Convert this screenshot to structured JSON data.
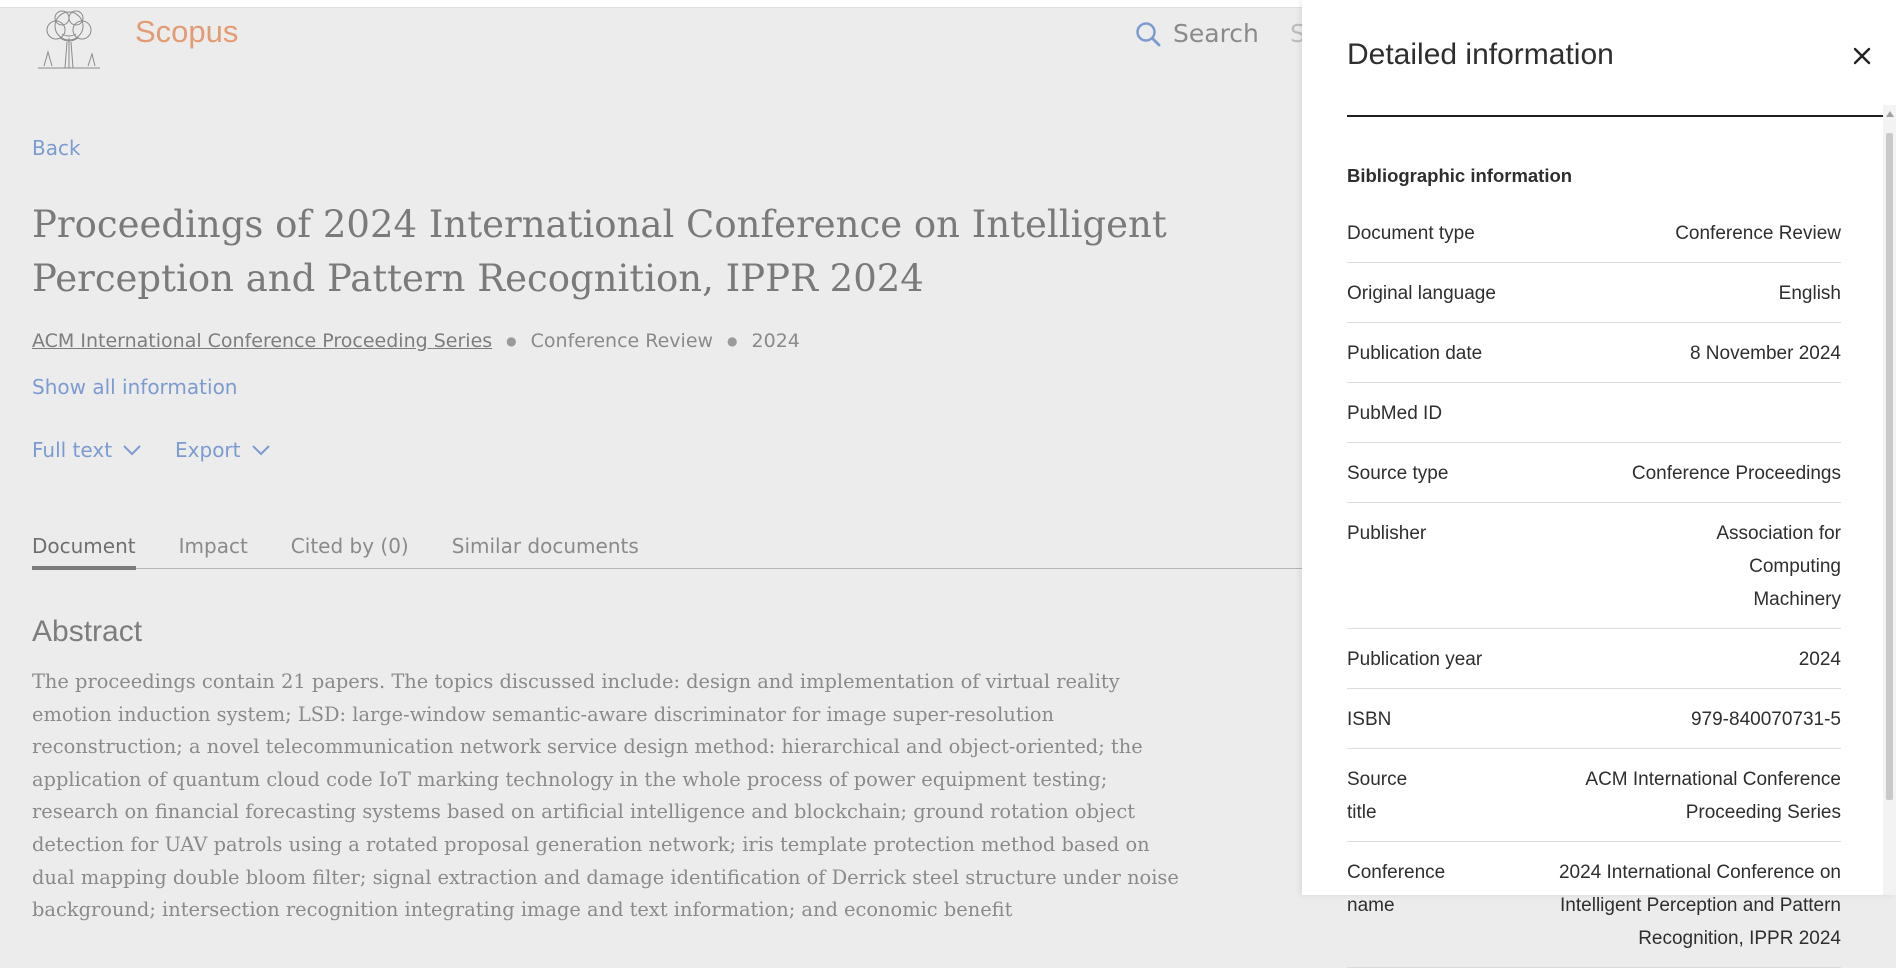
{
  "header": {
    "brand": "Scopus",
    "search_label": "Search",
    "search_next_cut": "S"
  },
  "nav": {
    "back_label": "Back"
  },
  "document": {
    "title": "Proceedings of 2024 International Conference on Intelligent Perception and Pattern Recognition, IPPR 2024",
    "source": "ACM International Conference Proceeding Series",
    "doc_type": "Conference Review",
    "year": "2024",
    "show_all": "Show all information",
    "actions": {
      "full_text": "Full text",
      "export": "Export"
    },
    "tabs": [
      "Document",
      "Impact",
      "Cited by (0)",
      "Similar documents"
    ],
    "abstract_heading": "Abstract",
    "abstract_text": "The proceedings contain 21 papers. The topics discussed include: design and implementation of virtual reality emotion induction system; LSD: large-window semantic-aware discriminator for image super-resolution reconstruction; a novel telecommunication network service design method: hierarchical and object-oriented; the application of quantum cloud code IoT marking technology in the whole process of power equipment testing; research on financial forecasting systems based on artificial intelligence and blockchain; ground rotation object detection for UAV patrols using a rotated proposal generation network; iris template protection method based on dual mapping double bloom filter; signal extraction and damage identification of Derrick steel structure under noise background; intersection recognition integrating image and text information; and economic benefit"
  },
  "panel": {
    "title": "Detailed information",
    "section_heading": "Bibliographic information",
    "rows": [
      {
        "key": "Document type",
        "value": "Conference Review"
      },
      {
        "key": "Original language",
        "value": "English"
      },
      {
        "key": "Publication date",
        "value": "8 November 2024"
      },
      {
        "key": "PubMed ID",
        "value": ""
      },
      {
        "key": "Source type",
        "value": "Conference Proceedings"
      },
      {
        "key": "Publisher",
        "value": "Association for Computing Machinery"
      },
      {
        "key": "Publication year",
        "value": "2024"
      },
      {
        "key": "ISBN",
        "value": "979-840070731-5"
      },
      {
        "key": "Source title",
        "value": "ACM International Conference Proceeding Series"
      },
      {
        "key": "Conference name",
        "value": "2024 International Conference on Intelligent Perception and Pattern Recognition, IPPR 2024"
      }
    ]
  },
  "colors": {
    "brand": "#e39b73",
    "link": "#7c9bd0",
    "overlay_bg": "#ececec",
    "panel_bg": "#ffffff"
  },
  "icons": [
    "tree-logo-icon",
    "search-icon",
    "chevron-down-icon",
    "close-icon"
  ]
}
